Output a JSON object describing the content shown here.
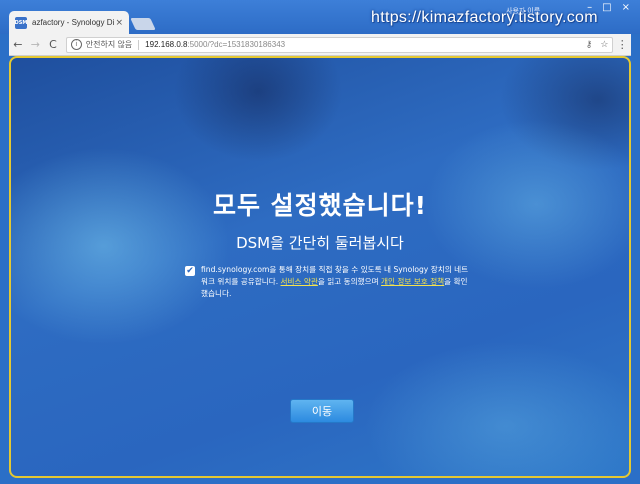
{
  "browser": {
    "tab_favicon": "DSM",
    "tab_title": "azfactory - Synology DiskStation",
    "tab_close": "×",
    "user_label": "사용자 이름",
    "watermark": "https://kimazfactory.tistory.com",
    "window_controls": [
      "–",
      "□",
      "×"
    ]
  },
  "toolbar": {
    "back_icon": "←",
    "forward_icon": "→",
    "reload_icon": "C",
    "info_icon": "i",
    "security_text": "안전하지 않음",
    "url_host": "192.168.0.8",
    "url_rest": ":5000/?dc=1531830186343",
    "key_icon": "⚷",
    "star_icon": "☆",
    "menu_icon": "⋮"
  },
  "main": {
    "headline": "모두 설정했습니다!",
    "subheadline": "DSM을 간단히 둘러봅시다",
    "consent": {
      "checked": true,
      "checkmark": "✔",
      "text_1": "find.synology.com을 통해 장치를 직접 찾을 수 있도록 내 Synology 장치의 네트워크 위치를 공유합니다. ",
      "link_1": "서비스 약관",
      "text_2": "을 읽고 동의했으며 ",
      "link_2": "개인 정보 보호 정책",
      "text_3": "을 확인했습니다."
    },
    "go_button": "이동"
  },
  "colors": {
    "accent_border": "#e4c832",
    "link": "#f5e34d",
    "button": "#2c8ae0"
  }
}
